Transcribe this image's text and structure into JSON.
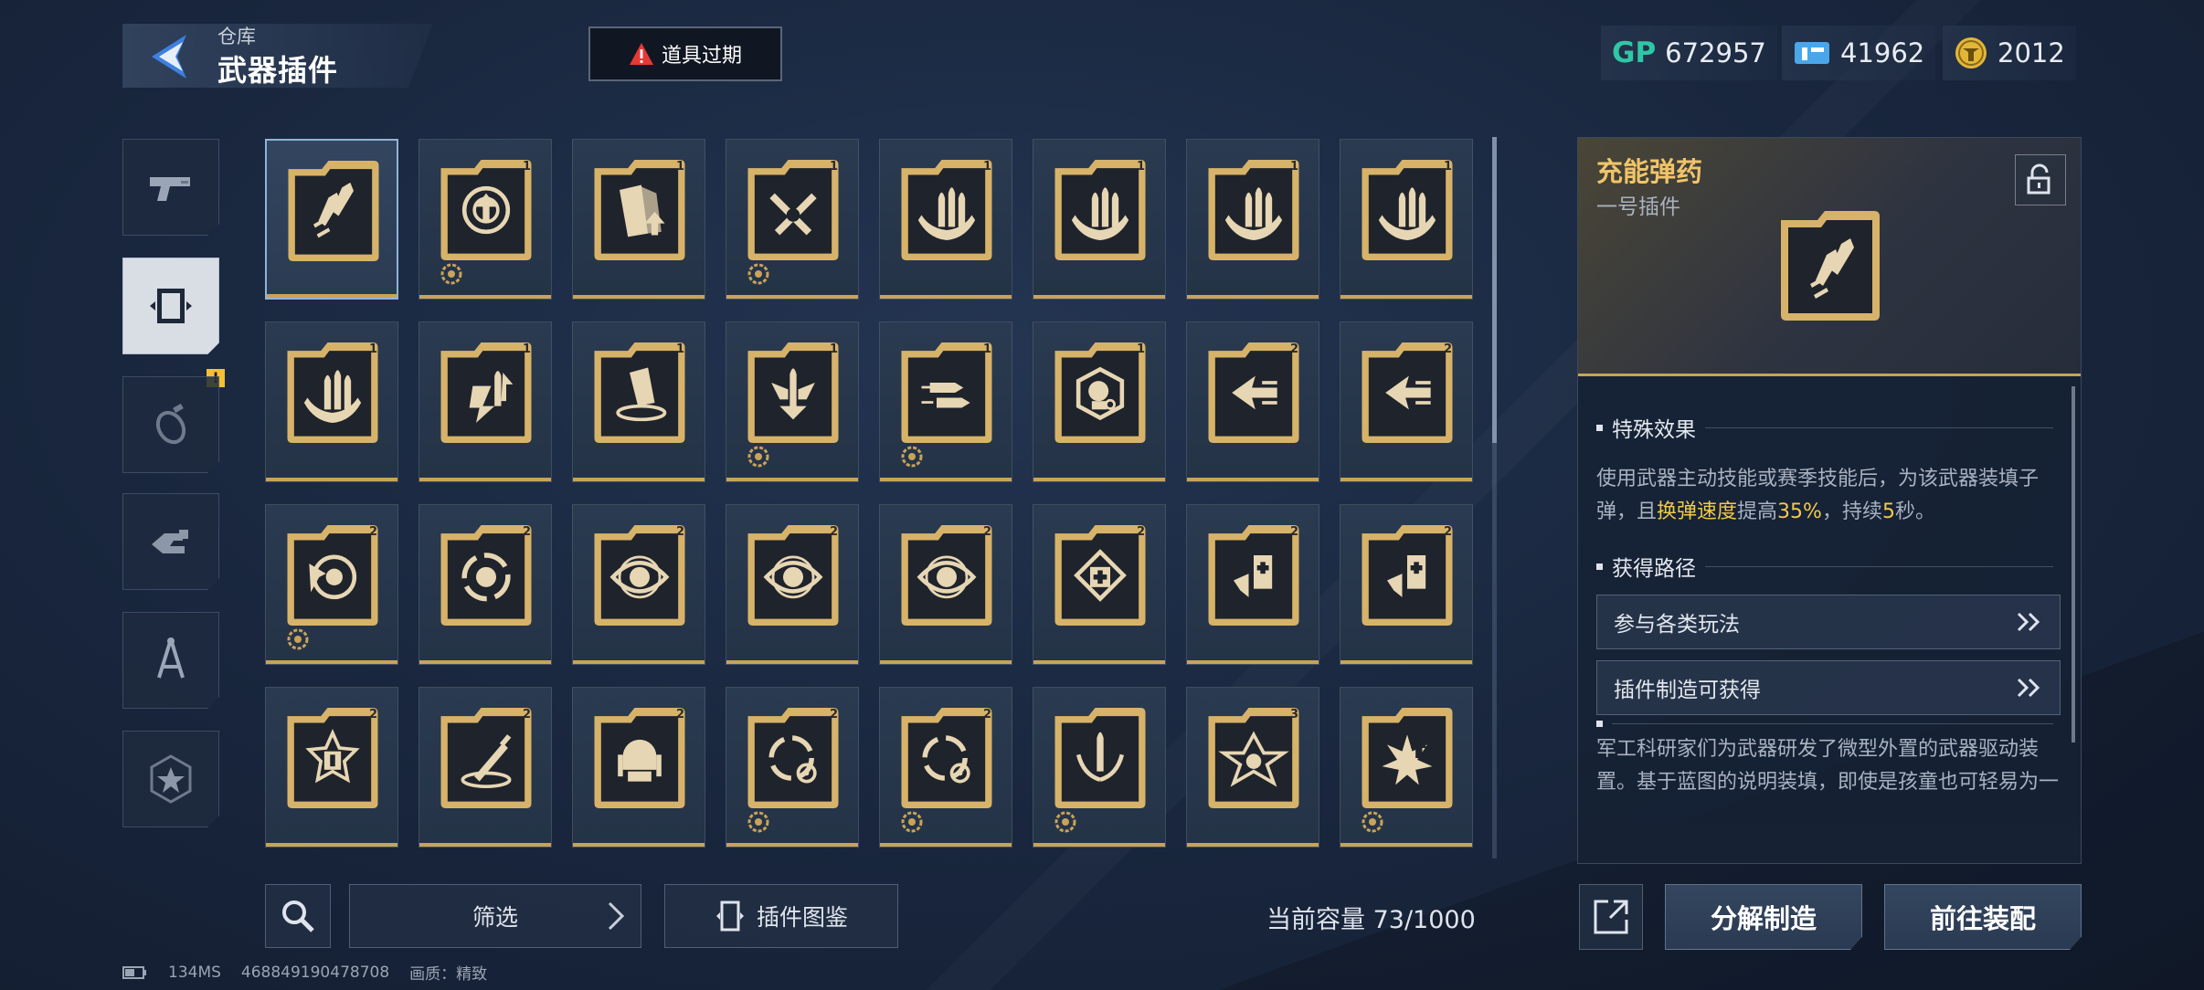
{
  "header": {
    "crumb": "仓库",
    "title": "武器插件",
    "expire_label": "道具过期"
  },
  "currencies": [
    {
      "icon": "gp-icon",
      "label": "GP",
      "value": "672957"
    },
    {
      "icon": "ticket-icon",
      "label": "",
      "value": "41962"
    },
    {
      "icon": "coin-icon",
      "label": "",
      "value": "2012"
    }
  ],
  "side_tabs": [
    {
      "name": "side-tab-weapons",
      "icon": "pistol-icon",
      "active": false
    },
    {
      "name": "side-tab-plugins",
      "icon": "plugin-chip-icon",
      "active": true
    },
    {
      "name": "side-tab-grenades",
      "icon": "grenade-icon",
      "active": false,
      "badge": "!"
    },
    {
      "name": "side-tab-gear",
      "icon": "hand-gear-icon",
      "active": false
    },
    {
      "name": "side-tab-blueprints",
      "icon": "compass-icon",
      "active": false
    },
    {
      "name": "side-tab-badges",
      "icon": "star-badge-icon",
      "active": false
    }
  ],
  "plugins": [
    {
      "icon": "bullets-rocket-icon",
      "lvl": "",
      "gear": false,
      "selected": true
    },
    {
      "icon": "crosshair-up-icon",
      "lvl": "1",
      "gear": true
    },
    {
      "icon": "magazine-up-icon",
      "lvl": "1",
      "gear": false
    },
    {
      "icon": "crossed-bullets-icon",
      "lvl": "1",
      "gear": true
    },
    {
      "icon": "triple-bullets-icon",
      "lvl": "1",
      "gear": false
    },
    {
      "icon": "triple-bullets-icon",
      "lvl": "1",
      "gear": false
    },
    {
      "icon": "triple-bullets-icon",
      "lvl": "1",
      "gear": false
    },
    {
      "icon": "triple-bullets-icon",
      "lvl": "1",
      "gear": false
    },
    {
      "icon": "triple-bullets-icon",
      "lvl": "1",
      "gear": false
    },
    {
      "icon": "bullet-arrows-icon",
      "lvl": "1",
      "gear": false
    },
    {
      "icon": "magazine-swirl-icon",
      "lvl": "1",
      "gear": false
    },
    {
      "icon": "bullet-wings-icon",
      "lvl": "1",
      "gear": true
    },
    {
      "icon": "speed-bullets-icon",
      "lvl": "1",
      "gear": true
    },
    {
      "icon": "head-target-icon",
      "lvl": "1",
      "gear": false
    },
    {
      "icon": "dash-arrow-icon",
      "lvl": "2",
      "gear": false
    },
    {
      "icon": "dash-arrow-icon",
      "lvl": "2",
      "gear": false
    },
    {
      "icon": "target-burst-icon",
      "lvl": "2",
      "gear": true
    },
    {
      "icon": "cycle-shield-icon",
      "lvl": "2",
      "gear": false
    },
    {
      "icon": "eye-icon",
      "lvl": "2",
      "gear": false
    },
    {
      "icon": "eye-icon",
      "lvl": "2",
      "gear": false
    },
    {
      "icon": "eye-icon",
      "lvl": "2",
      "gear": false
    },
    {
      "icon": "medkit-diamond-icon",
      "lvl": "2",
      "gear": false
    },
    {
      "icon": "medkit-arrow-icon",
      "lvl": "2",
      "gear": false
    },
    {
      "icon": "medkit-arrow-icon",
      "lvl": "2",
      "gear": false
    },
    {
      "icon": "medkit-star-icon",
      "lvl": "2",
      "gear": false
    },
    {
      "icon": "syringe-icon",
      "lvl": "2",
      "gear": false
    },
    {
      "icon": "helmet-icon",
      "lvl": "2",
      "gear": false
    },
    {
      "icon": "cycle-target-icon",
      "lvl": "2",
      "gear": true
    },
    {
      "icon": "cycle-target-icon",
      "lvl": "2",
      "gear": true
    },
    {
      "icon": "bullet-laurel-icon",
      "lvl": "",
      "gear": true
    },
    {
      "icon": "star-hex-icon",
      "lvl": "3",
      "gear": false
    },
    {
      "icon": "explosion-up-icon",
      "lvl": "",
      "gear": true
    }
  ],
  "toolbar": {
    "filter_label": "筛选",
    "catalog_label": "插件图鉴",
    "capacity_label": "当前容量 73/1000"
  },
  "status": {
    "ping": "134MS",
    "id": "468849190478708",
    "quality": "画质：精致"
  },
  "detail": {
    "name": "充能弹药",
    "slot": "一号插件",
    "effect_title": "特殊效果",
    "effect_pre": "使用武器主动技能或赛季技能后，为该武器装填子弹，且",
    "effect_hl1": "换弹速度",
    "effect_mid": "提高",
    "effect_hl2": "35%",
    "effect_mid2": "，持续",
    "effect_hl3": "5",
    "effect_post": "秒。",
    "route_title": "获得路径",
    "routes": [
      "参与各类玩法",
      "插件制造可获得"
    ],
    "lore": "军工科研家们为武器研发了微型外置的武器驱动装置。基于蓝图的说明装填，即使是孩童也可轻易为一"
  },
  "actions": {
    "dismantle": "分解制造",
    "equip": "前往装配"
  },
  "colors": {
    "gold": "#c9a35a",
    "highlight": "#f2c94c",
    "accent_teal": "#2fc7a6",
    "warning": "#e53935"
  }
}
